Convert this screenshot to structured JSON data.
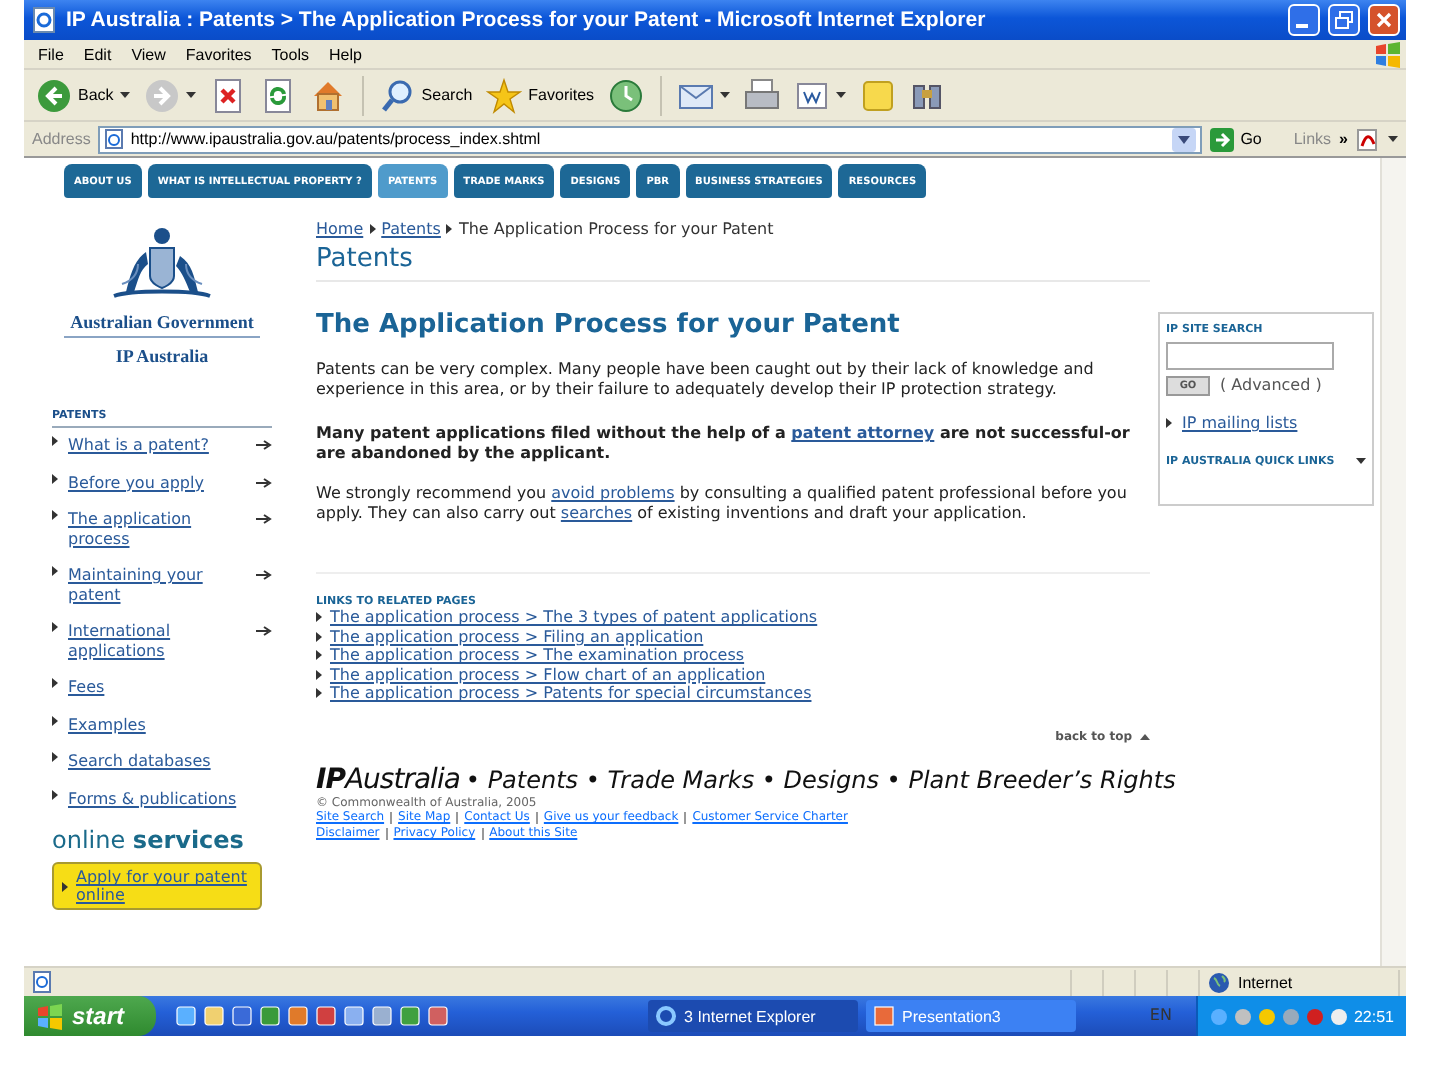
{
  "window": {
    "title": "IP Australia : Patents > The Application Process for your Patent - Microsoft Internet Explorer"
  },
  "menu": [
    "File",
    "Edit",
    "View",
    "Favorites",
    "Tools",
    "Help"
  ],
  "toolbar": [
    {
      "kind": "back",
      "label": "Back",
      "dropdown": true
    },
    {
      "kind": "forward",
      "dropdown": true
    },
    {
      "kind": "stop",
      "dropdown": false
    },
    {
      "kind": "refresh",
      "dropdown": false
    },
    {
      "kind": "home",
      "dropdown": false
    },
    {
      "kind": "search",
      "label": "Search",
      "dropdown": false
    },
    {
      "kind": "favorites",
      "label": "Favorites",
      "dropdown": false
    },
    {
      "kind": "history",
      "dropdown": false
    },
    {
      "kind": "mail",
      "dropdown": true
    },
    {
      "kind": "print",
      "dropdown": false
    },
    {
      "kind": "edit",
      "dropdown": true
    },
    {
      "kind": "note",
      "dropdown": false
    },
    {
      "kind": "research",
      "dropdown": false
    }
  ],
  "address": {
    "label": "Address",
    "url": "http://www.ipaustralia.gov.au/patents/process_index.shtml",
    "go": "Go",
    "links": "Links",
    "more": "»"
  },
  "nav_tabs": [
    {
      "label": "ABOUT US",
      "selected": false
    },
    {
      "label": "WHAT IS INTELLECTUAL PROPERTY ?",
      "selected": false
    },
    {
      "label": "PATENTS",
      "selected": true
    },
    {
      "label": "TRADE MARKS",
      "selected": false
    },
    {
      "label": "DESIGNS",
      "selected": false
    },
    {
      "label": "PBR",
      "selected": false
    },
    {
      "label": "BUSINESS STRATEGIES",
      "selected": false
    },
    {
      "label": "RESOURCES",
      "selected": false
    }
  ],
  "sidebar": {
    "agency": "Australian Government",
    "org": "IP Australia",
    "heading": "PATENTS",
    "items": [
      {
        "label": "What is a patent?",
        "has_arrow": true
      },
      {
        "label": "Before you apply",
        "has_arrow": true
      },
      {
        "label": "The application process",
        "has_arrow": true
      },
      {
        "label": "Maintaining your patent",
        "has_arrow": true
      },
      {
        "label": "International applications",
        "has_arrow": true
      },
      {
        "label": "Fees",
        "has_arrow": false
      },
      {
        "label": "Examples",
        "has_arrow": false
      },
      {
        "label": "Search databases",
        "has_arrow": false
      },
      {
        "label": "Forms & publications",
        "has_arrow": false
      }
    ],
    "online": "online **services**",
    "apply": "Apply for your patent online"
  },
  "breadcrumb": [
    {
      "label": "Home",
      "link": true
    },
    {
      "label": "Patents",
      "link": true
    },
    {
      "label": "The Application Process for your Patent",
      "link": false
    }
  ],
  "section_title": "Patents",
  "heading": "The Application Process for your Patent",
  "paragraphs": [
    {
      "bold": false,
      "parts": [
        {
          "text": "Patents can be very complex. Many people have been caught out by their lack of knowledge and experience in this area, or by their failure to adequately develop their IP protection strategy.",
          "link": false
        }
      ]
    },
    {
      "bold": true,
      "parts": [
        {
          "text": "Many patent applications filed without the help of a ",
          "link": false
        },
        {
          "text": "patent attorney",
          "link": true
        },
        {
          "text": " are not successful-or are abandoned by the applicant.",
          "link": false
        }
      ]
    },
    {
      "bold": false,
      "parts": [
        {
          "text": "We strongly recommend you ",
          "link": false
        },
        {
          "text": "avoid problems",
          "link": true
        },
        {
          "text": " by consulting a qualified patent professional before you apply. They can also carry out ",
          "link": false
        },
        {
          "text": "searches",
          "link": true
        },
        {
          "text": " of existing inventions and draft your application.",
          "link": false
        }
      ]
    }
  ],
  "related": {
    "heading": "LINKS TO RELATED PAGES",
    "links": [
      "The application process > The 3 types of patent applications",
      "The application process > Filing an application",
      "The application process > The examination process",
      "The application process > Flow chart of an application",
      "The application process > Patents for special circumstances"
    ]
  },
  "back_to_top": "back to top",
  "footer": {
    "brand": "**IP**Australia",
    "tagline": "• Patents • Trade Marks • Designs • Plant Breeder’s Rights",
    "copyright": "© Commonwealth of Australia, 2005",
    "links": [
      [
        "Site Search",
        "Site Map",
        "Contact Us",
        "Give us your feedback",
        "Customer Service Charter"
      ],
      [
        "Disclaimer",
        "Privacy Policy",
        "About this Site"
      ]
    ]
  },
  "search_box": {
    "heading": "IP SITE SEARCH",
    "button": "GO",
    "advanced": "( Advanced )",
    "mailing": "IP mailing lists",
    "quick_links": "IP AUSTRALIA QUICK LINKS"
  },
  "status_bar": {
    "zone": "Internet"
  },
  "taskbar": {
    "start": "start",
    "tasks": [
      {
        "label": "3 Internet Explorer",
        "selected": true
      },
      {
        "label": "Presentation3",
        "selected": false
      }
    ],
    "language": "EN",
    "clock": "22:51"
  }
}
